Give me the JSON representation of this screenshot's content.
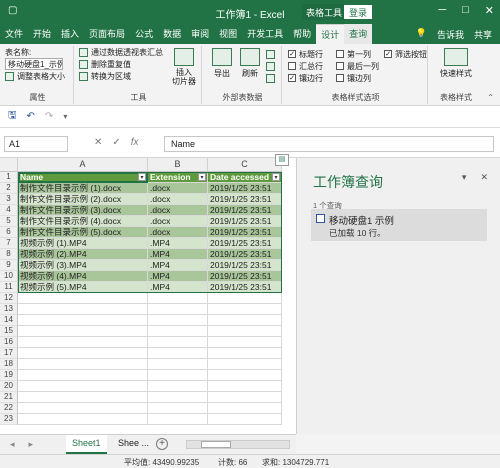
{
  "titlebar": {
    "title": "工作簿1 - Excel",
    "context_label": "表格工具",
    "login_label": "登录",
    "minimize": "─",
    "restore": "□",
    "close": "✕"
  },
  "tabs": [
    {
      "label": "文件"
    },
    {
      "label": "开始"
    },
    {
      "label": "插入"
    },
    {
      "label": "页面布局"
    },
    {
      "label": "公式"
    },
    {
      "label": "数据"
    },
    {
      "label": "审阅"
    },
    {
      "label": "视图"
    },
    {
      "label": "开发工具"
    },
    {
      "label": "帮助"
    },
    {
      "label": "设计"
    },
    {
      "label": "查询"
    }
  ],
  "tabs_right": {
    "tell_me": "告诉我",
    "share": "共享"
  },
  "ribbon": {
    "properties": {
      "table_name_label": "表名称:",
      "table_name_value": "移动硬盘1_示例",
      "resize_label": "调整表格大小",
      "group_name": "属性"
    },
    "tools": {
      "pivot_label": "通过数据透视表汇总",
      "remove_dup_label": "删除重复值",
      "convert_label": "转换为区域",
      "slicer_label": "插入\n切片器",
      "group_name": "工具"
    },
    "external": {
      "export_label": "导出",
      "refresh_label": "刷新",
      "group_name": "外部表数据"
    },
    "style_options": {
      "header_row": {
        "label": "标题行",
        "checked": true
      },
      "total_row": {
        "label": "汇总行",
        "checked": false
      },
      "banded_rows": {
        "label": "镶边行",
        "checked": true
      },
      "first_col": {
        "label": "第一列",
        "checked": false
      },
      "last_col": {
        "label": "最后一列",
        "checked": false
      },
      "banded_cols": {
        "label": "镶边列",
        "checked": false
      },
      "filter_button": {
        "label": "筛选按钮",
        "checked": true
      },
      "group_name": "表格样式选项"
    },
    "styles": {
      "quick_label": "快速样式",
      "group_name": "表格样式"
    }
  },
  "formula_bar": {
    "name_box": "A1",
    "cancel": "✕",
    "enter": "✓",
    "fx": "fx",
    "content": "Name"
  },
  "grid": {
    "columns": [
      "A",
      "B",
      "C"
    ],
    "rows": [
      "1",
      "2",
      "3",
      "4",
      "5",
      "6",
      "7",
      "8",
      "9",
      "10",
      "11",
      "12",
      "13",
      "14",
      "15",
      "16",
      "17",
      "18",
      "19",
      "20",
      "21",
      "22",
      "23"
    ],
    "header": [
      "Name",
      "Extension",
      "Date accessed"
    ],
    "data": [
      [
        "制作文件目录示例 (1).docx",
        ".docx",
        "2019/1/25 23:51"
      ],
      [
        "制作文件目录示例 (2).docx",
        ".docx",
        "2019/1/25 23:51"
      ],
      [
        "制作文件目录示例 (3).docx",
        ".docx",
        "2019/1/25 23:51"
      ],
      [
        "制作文件目录示例 (4).docx",
        ".docx",
        "2019/1/25 23:51"
      ],
      [
        "制作文件目录示例 (5).docx",
        ".docx",
        "2019/1/25 23:51"
      ],
      [
        "视频示例 (1).MP4",
        ".MP4",
        "2019/1/25 23:51"
      ],
      [
        "视频示例 (2).MP4",
        ".MP4",
        "2019/1/25 23:51"
      ],
      [
        "视频示例 (3).MP4",
        ".MP4",
        "2019/1/25 23:51"
      ],
      [
        "视频示例 (4).MP4",
        ".MP4",
        "2019/1/25 23:51"
      ],
      [
        "视频示例 (5).MP4",
        ".MP4",
        "2019/1/25 23:51"
      ]
    ]
  },
  "pane": {
    "title": "工作簿查询",
    "query_count": "1 个查询",
    "query_name": "移动硬盘1 示例",
    "query_status": "已加载 10 行。"
  },
  "sheets": {
    "tabs": [
      "Sheet1",
      "Shee ..."
    ],
    "add": "+"
  },
  "status": {
    "average": "平均值: 43490.99235",
    "count": "计数: 66",
    "sum": "求和: 1304729.771"
  },
  "colors": {
    "accent": "#217346",
    "header_fill": "#5f9b3c",
    "band_dark": "#a9c59a",
    "band_light": "#d5e4cc"
  }
}
